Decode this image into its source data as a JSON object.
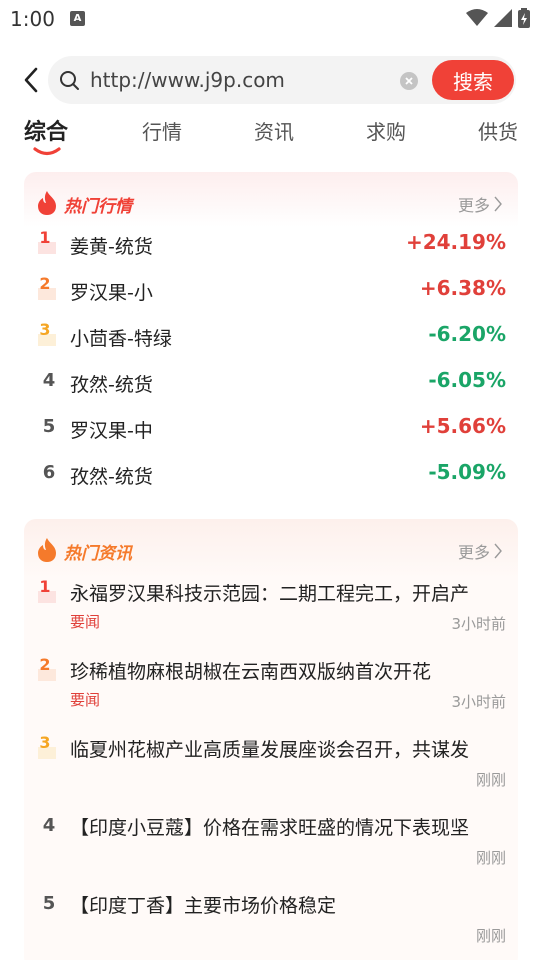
{
  "status_bar": {
    "time": "1:00",
    "notif_letter": "A"
  },
  "search": {
    "value": "http://www.j9p.com",
    "button_label": "搜索"
  },
  "tabs": [
    {
      "label": "综合",
      "active": true
    },
    {
      "label": "行情",
      "active": false
    },
    {
      "label": "资讯",
      "active": false
    },
    {
      "label": "求购",
      "active": false
    },
    {
      "label": "供货",
      "active": false
    }
  ],
  "hot_market": {
    "title": "热门行情",
    "more_label": "更多",
    "items": [
      {
        "rank": "1",
        "name": "姜黄-统货",
        "change": "+24.19%",
        "direction": "up"
      },
      {
        "rank": "2",
        "name": "罗汉果-小",
        "change": "+6.38%",
        "direction": "up"
      },
      {
        "rank": "3",
        "name": "小茴香-特绿",
        "change": "-6.20%",
        "direction": "down"
      },
      {
        "rank": "4",
        "name": "孜然-统货",
        "change": "-6.05%",
        "direction": "down"
      },
      {
        "rank": "5",
        "name": "罗汉果-中",
        "change": "+5.66%",
        "direction": "up"
      },
      {
        "rank": "6",
        "name": "孜然-统货",
        "change": "-5.09%",
        "direction": "down"
      }
    ]
  },
  "hot_news": {
    "title": "热门资讯",
    "more_label": "更多",
    "items": [
      {
        "rank": "1",
        "title": "永福罗汉果科技示范园：二期工程完工，开启产",
        "tag": "要闻",
        "time": "3小时前"
      },
      {
        "rank": "2",
        "title": "珍稀植物麻根胡椒在云南西双版纳首次开花",
        "tag": "要闻",
        "time": "3小时前"
      },
      {
        "rank": "3",
        "title": "临夏州花椒产业高质量发展座谈会召开，共谋发",
        "tag": "",
        "time": "刚刚"
      },
      {
        "rank": "4",
        "title": "【印度小豆蔻】价格在需求旺盛的情况下表现坚",
        "tag": "",
        "time": "刚刚"
      },
      {
        "rank": "5",
        "title": "【印度丁香】主要市场价格稳定",
        "tag": "",
        "time": "刚刚"
      }
    ]
  },
  "colors": {
    "accent": "#f04137",
    "up": "#e0403a",
    "down": "#1aa567",
    "rank1": "#f04137",
    "rank2": "#f57a2b",
    "rank3": "#f5a623"
  }
}
